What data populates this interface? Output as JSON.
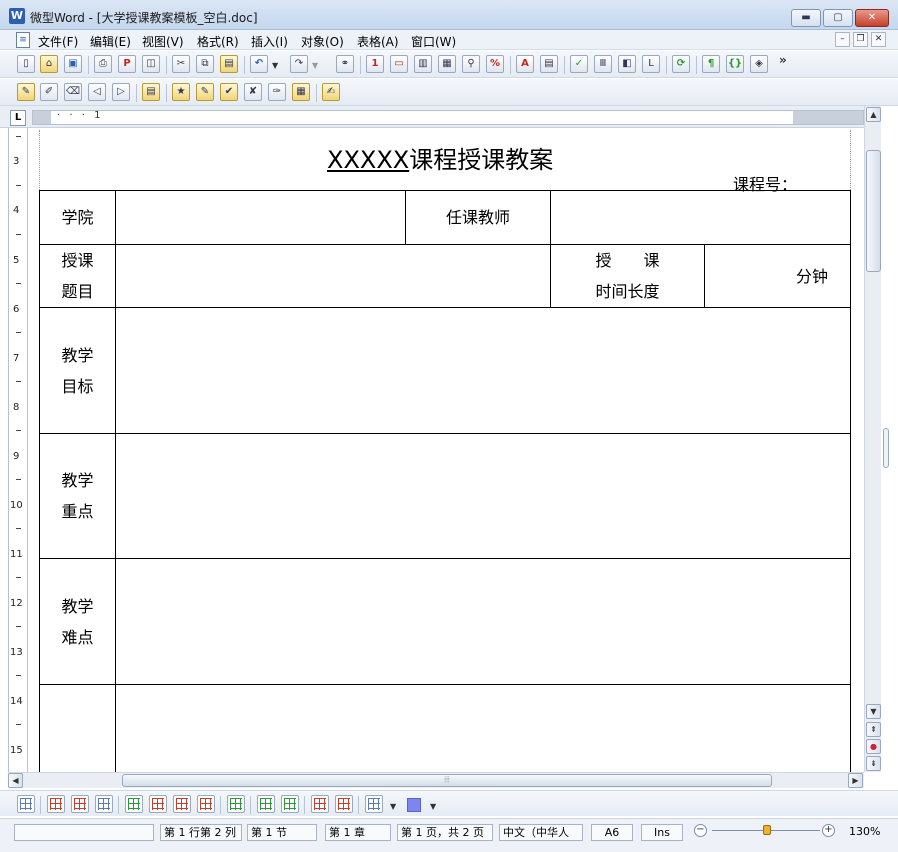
{
  "window": {
    "title": "微型Word - [大学授课教案模板_空白.doc]",
    "app_icon_glyph": "W",
    "controls": {
      "minimize": "▬",
      "maximize": "▢",
      "close": "✕"
    }
  },
  "menubar": {
    "items": [
      "文件(F)",
      "编辑(E)",
      "视图(V)",
      "格式(R)",
      "插入(I)",
      "对象(O)",
      "表格(A)",
      "窗口(W)"
    ],
    "mdi_controls": {
      "minimize": "–",
      "restore": "❐",
      "close": "✕"
    }
  },
  "toolbar_overflow": "»",
  "document": {
    "title_underlined": "XXXXX",
    "title_rest": "课程授课教案",
    "course_number_label": "课程号：",
    "table": {
      "college_label": "学院",
      "teacher_label": "任课教师",
      "topic_label_line1": "授课",
      "topic_label_line2": "题目",
      "duration_label_line1": "授　　课",
      "duration_label_line2": "时间长度",
      "duration_unit": "分钟",
      "goals_line1": "教学",
      "goals_line2": "目标",
      "key_points_line1": "教学",
      "key_points_line2": "重点",
      "difficulties_line1": "教学",
      "difficulties_line2": "难点"
    }
  },
  "vertical_ruler_numbers": [
    "3",
    "4",
    "5",
    "6",
    "7",
    "8",
    "9",
    "10",
    "11",
    "12",
    "13",
    "14",
    "15"
  ],
  "ruler": {
    "tab_selector": "L",
    "marks": "· · · 1"
  },
  "statusbar": {
    "line_col": "第 1 行第 2 列",
    "section": "第 1 节",
    "chapter": "第 1 章",
    "page": "第 1 页，共 2 页",
    "language": "中文（中华人",
    "style": "A6",
    "insert_mode": "Ins",
    "zoom": "130%"
  },
  "colors": {
    "title_bar": "#c4d7ee",
    "close_button": "#c4412b",
    "table_fill_swatch": "#7c86f0",
    "zoom_knob": "#f0b030"
  }
}
